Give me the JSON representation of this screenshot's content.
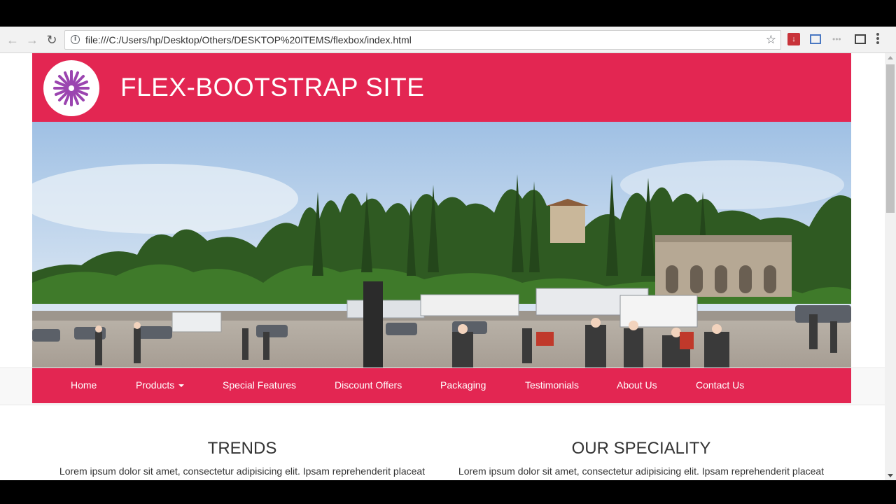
{
  "browser": {
    "url": "file:///C:/Users/hp/Desktop/Others/DESKTOP%20ITEMS/flexbox/index.html",
    "nav": [
      "back-icon",
      "forward-icon",
      "reload-icon"
    ],
    "extensions": [
      "bookmark-star-icon",
      "pdf-extension-icon",
      "screenshot-extension-icon",
      "more-extensions-icon",
      "frame-icon",
      "menu-icon"
    ]
  },
  "site": {
    "title": "FLEX-BOOTSTRAP SITE",
    "brand_color": "#e32652",
    "logo_color": "#9b45b0"
  },
  "navbar": {
    "items": [
      {
        "label": "Home"
      },
      {
        "label": "Products"
      },
      {
        "label": "Special Features"
      },
      {
        "label": "Discount Offers"
      },
      {
        "label": "Packaging"
      },
      {
        "label": "Testimonials"
      },
      {
        "label": "About Us"
      },
      {
        "label": "Contact Us"
      }
    ]
  },
  "sections": [
    {
      "title": "TRENDS",
      "text": "Lorem ipsum dolor sit amet, consectetur adipisicing elit. Ipsam reprehenderit placeat"
    },
    {
      "title": "OUR SPECIALITY",
      "text": "Lorem ipsum dolor sit amet, consectetur adipisicing elit. Ipsam reprehenderit placeat"
    }
  ]
}
